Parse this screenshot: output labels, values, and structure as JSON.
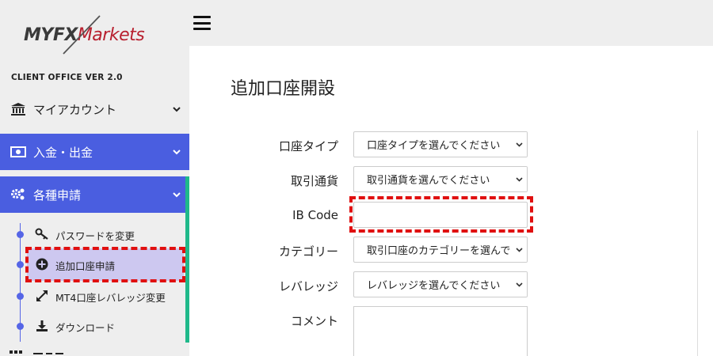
{
  "sidebar": {
    "logo": {
      "myfx": "MYFX",
      "markets": "Markets"
    },
    "client_office": "CLIENT OFFICE VER 2.0",
    "items": [
      {
        "label": "マイアカウント",
        "icon": "bank-icon"
      },
      {
        "label": "入金・出金",
        "icon": "money-icon"
      },
      {
        "label": "各種申請",
        "icon": "gears-icon"
      }
    ],
    "sub_items": [
      {
        "label": "パスワードを変更",
        "icon": "key-icon"
      },
      {
        "label": "追加口座申請",
        "icon": "plus-circle-icon"
      },
      {
        "label": "MT4口座レバレッジ変更",
        "icon": "expand-arrows-icon"
      },
      {
        "label": "ダウンロード",
        "icon": "download-icon"
      }
    ]
  },
  "main": {
    "title": "追加口座開設",
    "form": {
      "account_type": {
        "label": "口座タイプ",
        "value": "口座タイプを選んでください"
      },
      "currency": {
        "label": "取引通貨",
        "value": "取引通貨を選んでください"
      },
      "ib_code": {
        "label": "IB Code",
        "value": ""
      },
      "category": {
        "label": "カテゴリー",
        "value": "取引口座のカテゴリーを選んでください"
      },
      "leverage": {
        "label": "レバレッジ",
        "value": "レバレッジを選んでください"
      },
      "comment": {
        "label": "コメント",
        "value": ""
      }
    }
  },
  "colors": {
    "accent": "#4a5ee0",
    "active_sub": "#cdc8f0",
    "green_bar": "#1fb98a",
    "highlight": "#e01010",
    "brand_red": "#b8202f"
  }
}
